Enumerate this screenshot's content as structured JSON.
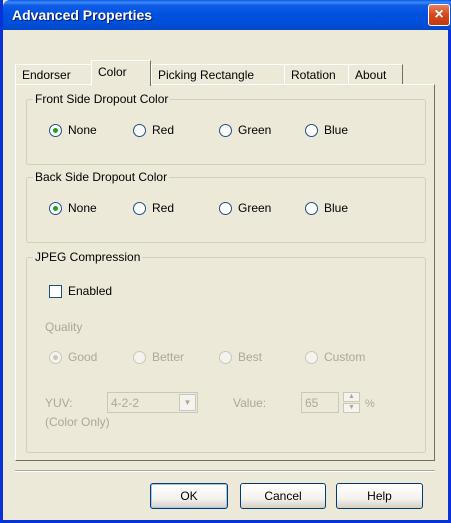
{
  "window": {
    "title": "Advanced Properties",
    "close_label": "×"
  },
  "tabs": [
    {
      "label": "Endorser"
    },
    {
      "label": "Color"
    },
    {
      "label": "Picking Rectangle"
    },
    {
      "label": "Rotation"
    },
    {
      "label": "About"
    }
  ],
  "front": {
    "title": "Front Side Dropout Color",
    "options": [
      "None",
      "Red",
      "Green",
      "Blue"
    ],
    "selected": "None"
  },
  "back": {
    "title": "Back Side Dropout Color",
    "options": [
      "None",
      "Red",
      "Green",
      "Blue"
    ],
    "selected": "None"
  },
  "jpeg": {
    "title": "JPEG Compression",
    "enabled_label": "Enabled",
    "enabled": false,
    "quality_label": "Quality",
    "quality_options": [
      "Good",
      "Better",
      "Best",
      "Custom"
    ],
    "quality_selected": "Good",
    "yuv_label": "YUV:",
    "yuv_note": "(Color Only)",
    "yuv_value": "4-2-2",
    "value_label": "Value:",
    "value": "65",
    "value_unit": "%"
  },
  "buttons": {
    "ok": "OK",
    "cancel": "Cancel",
    "help": "Help"
  }
}
